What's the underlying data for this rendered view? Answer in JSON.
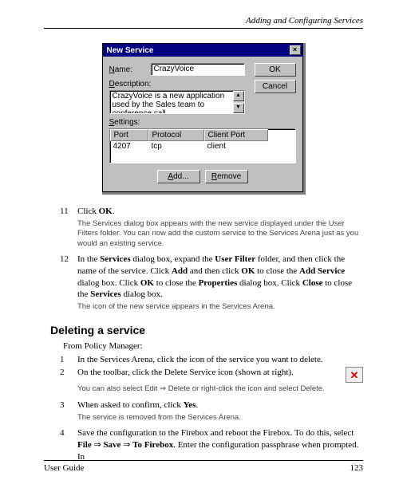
{
  "header": {
    "chapter": "Adding and Configuring Services"
  },
  "dialog": {
    "title": "New Service",
    "name_label": "Name:",
    "name_value": "CrazyVoice",
    "desc_label": "Description:",
    "desc_value": "CrazyVoice is a new application used by the Sales team to conference call",
    "ok_label": "OK",
    "cancel_label": "Cancel",
    "settings_label": "Settings:",
    "table": {
      "headers": [
        "Port",
        "Protocol",
        "Client Port"
      ],
      "row": [
        "4207",
        "tcp",
        "client"
      ]
    },
    "add_label": "Add...",
    "remove_label": "Remove"
  },
  "steps_a": [
    {
      "num": "11",
      "body_pre": "Click ",
      "bold": "OK",
      "body_post": "."
    },
    {
      "num": "12",
      "body": "In the Services dialog box, expand the User Filter folder, and then click the name of the service. Click Add and then click OK to close the Add Service dialog box. Click OK to close the Properties dialog box. Click Close to close the Services dialog box."
    }
  ],
  "notes_a": [
    "The Services dialog box appears with the new service displayed under the User Filters folder. You can now add the custom service to the Services Arena just as you would an existing service.",
    "The icon of the new service appears in the Services Arena."
  ],
  "section": {
    "heading": "Deleting a service",
    "intro": "From Policy Manager:"
  },
  "steps_b": [
    {
      "num": "1",
      "body": "In the Services Arena, click the icon of the service you want to delete."
    },
    {
      "num": "2",
      "body": "On the toolbar, click the Delete Service icon (shown at right)."
    },
    {
      "num": "3",
      "body": "When asked to confirm, click Yes."
    },
    {
      "num": "4",
      "body": "Save the configuration to the Firebox and reboot the Firebox. To do this, select File ⇒ Save ⇒ To Firebox. Enter the configuration passphrase when prompted. In"
    }
  ],
  "notes_b": [
    "You can also select Edit ⇒ Delete or right-click the icon and select Delete.",
    "The service is removed from the Services Arena."
  ],
  "footer": {
    "left": "User Guide",
    "right": "123"
  }
}
